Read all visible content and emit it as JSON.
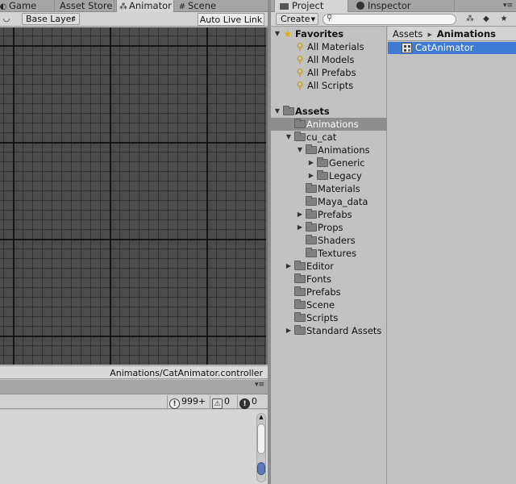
{
  "left_tabs": [
    {
      "label": "Game",
      "icon": "pacman-icon",
      "glyph": "◐"
    },
    {
      "label": "Asset Store",
      "icon": "",
      "glyph": ""
    },
    {
      "label": "Animator",
      "icon": "animator-icon",
      "glyph": "⁂"
    },
    {
      "label": "Scene",
      "icon": "grid-icon",
      "glyph": "#"
    }
  ],
  "animator": {
    "layer_dropdown": "Base Layer",
    "live_link": "Auto Live Link",
    "controller_path": "Animations/CatAnimator.controller"
  },
  "console": {
    "info_count": "999+",
    "warning_count": "0",
    "error_count": "0"
  },
  "right_tabs": [
    {
      "label": "Project"
    },
    {
      "label": "Inspector"
    }
  ],
  "project_toolbar": {
    "create_label": "Create"
  },
  "tree": [
    {
      "label": "Favorites",
      "depth": 0,
      "type": "header-fav",
      "expanded": true
    },
    {
      "label": "All Materials",
      "depth": 1,
      "type": "search"
    },
    {
      "label": "All Models",
      "depth": 1,
      "type": "search"
    },
    {
      "label": "All Prefabs",
      "depth": 1,
      "type": "search"
    },
    {
      "label": "All Scripts",
      "depth": 1,
      "type": "search"
    },
    {
      "label": "",
      "depth": 0,
      "type": "gap"
    },
    {
      "label": "Assets",
      "depth": 0,
      "type": "header-folder",
      "expanded": true
    },
    {
      "label": "Animations",
      "depth": 1,
      "type": "folder",
      "selected": true
    },
    {
      "label": "cu_cat",
      "depth": 1,
      "type": "folder",
      "expanded": true
    },
    {
      "label": "Animations",
      "depth": 2,
      "type": "folder",
      "expanded": true
    },
    {
      "label": "Generic",
      "depth": 3,
      "type": "folder",
      "collapsed": true
    },
    {
      "label": "Legacy",
      "depth": 3,
      "type": "folder",
      "collapsed": true
    },
    {
      "label": "Materials",
      "depth": 2,
      "type": "folder"
    },
    {
      "label": "Maya_data",
      "depth": 2,
      "type": "folder"
    },
    {
      "label": "Prefabs",
      "depth": 2,
      "type": "folder",
      "collapsed": true
    },
    {
      "label": "Props",
      "depth": 2,
      "type": "folder",
      "collapsed": true
    },
    {
      "label": "Shaders",
      "depth": 2,
      "type": "folder"
    },
    {
      "label": "Textures",
      "depth": 2,
      "type": "folder"
    },
    {
      "label": "Editor",
      "depth": 1,
      "type": "folder",
      "collapsed": true
    },
    {
      "label": "Fonts",
      "depth": 1,
      "type": "folder"
    },
    {
      "label": "Prefabs",
      "depth": 1,
      "type": "folder"
    },
    {
      "label": "Scene",
      "depth": 1,
      "type": "folder"
    },
    {
      "label": "Scripts",
      "depth": 1,
      "type": "folder"
    },
    {
      "label": "Standard Assets",
      "depth": 1,
      "type": "folder",
      "collapsed": true
    }
  ],
  "breadcrumb": {
    "root": "Assets",
    "current": "Animations"
  },
  "assets": [
    {
      "label": "CatAnimator",
      "icon": "animator-controller-icon",
      "selected": true
    }
  ]
}
